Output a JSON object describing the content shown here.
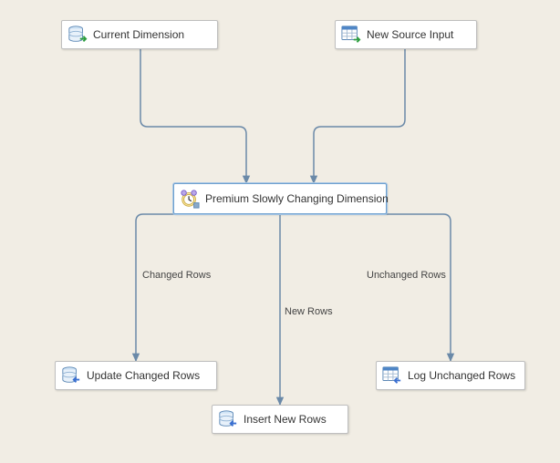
{
  "nodes": {
    "current_dimension": {
      "label": "Current Dimension"
    },
    "new_source_input": {
      "label": "New Source Input"
    },
    "premium_scd": {
      "label": "Premium Slowly Changing Dimension"
    },
    "update_changed_rows": {
      "label": "Update Changed Rows"
    },
    "log_unchanged_rows": {
      "label": "Log Unchanged Rows"
    },
    "insert_new_rows": {
      "label": "Insert New Rows"
    }
  },
  "edges": {
    "changed_rows": {
      "label": "Changed Rows"
    },
    "new_rows": {
      "label": "New Rows"
    },
    "unchanged_rows": {
      "label": "Unchanged Rows"
    }
  }
}
